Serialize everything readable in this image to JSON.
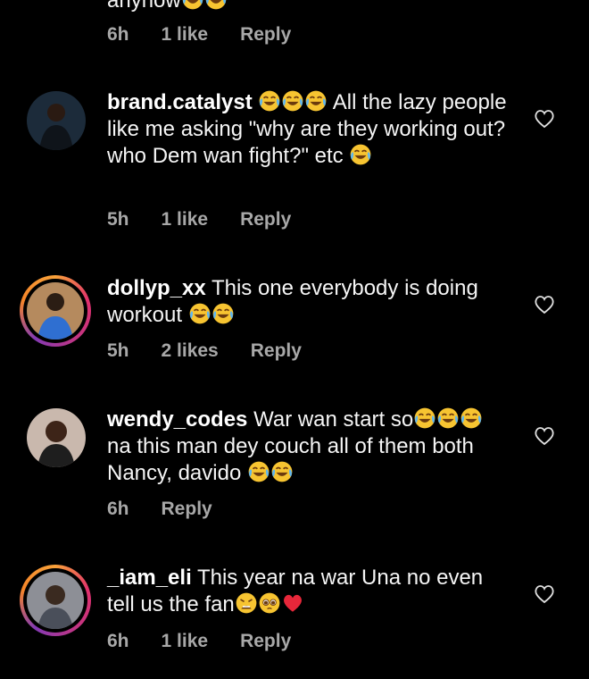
{
  "comments": [
    {
      "username": "",
      "text_before": "anyhow",
      "emoji_after": [
        "laugh",
        "laugh"
      ],
      "time": "6h",
      "likes": "1 like",
      "reply": "Reply"
    },
    {
      "username": "brand.catalyst",
      "emoji_before": [
        "laugh",
        "laugh",
        "laugh"
      ],
      "text": "All the lazy people like me asking \"why are they working out? who Dem wan fight?\" etc",
      "emoji_after": [
        "laugh"
      ],
      "time": "5h",
      "likes": "1 like",
      "reply": "Reply",
      "has_story_ring": false
    },
    {
      "username": "dollyp_xx",
      "text": "This one everybody is doing workout",
      "emoji_after": [
        "laugh",
        "laugh"
      ],
      "time": "5h",
      "likes": "2 likes",
      "reply": "Reply",
      "has_story_ring": true
    },
    {
      "username": "wendy_codes",
      "text": "War wan start so",
      "emoji_mid": [
        "laugh",
        "laugh",
        "laugh"
      ],
      "text_2": "na this man dey couch all of them both Nancy, davido",
      "emoji_after": [
        "laugh",
        "laugh"
      ],
      "time": "6h",
      "likes": "",
      "reply": "Reply",
      "has_story_ring": false
    },
    {
      "username": "_iam_eli",
      "text": "This year na war Una no even tell us the fan",
      "emoji_after": [
        "weary",
        "pleading",
        "red-heart"
      ],
      "time": "6h",
      "likes": "1 like",
      "reply": "Reply",
      "has_story_ring": true
    }
  ],
  "colors": {
    "background": "#000000",
    "text": "#f5f5f5",
    "meta": "#a8a8a8",
    "emoji_yellow": "#f7c431",
    "heart_red": "#e8273a"
  },
  "icons": {
    "like": "heart-outline-icon",
    "laugh": "face-with-tears-of-joy-emoji",
    "weary": "weary-face-emoji",
    "pleading": "pleading-face-emoji",
    "red-heart": "red-heart-emoji"
  }
}
